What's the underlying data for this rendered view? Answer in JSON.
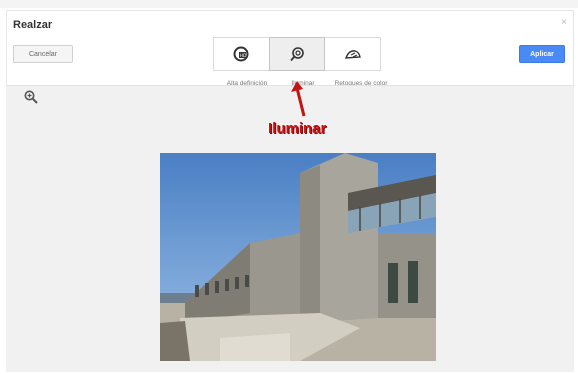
{
  "dialog": {
    "title": "Realzar",
    "close_glyph": "×",
    "cancel_label": "Cancelar",
    "apply_label": "Aplicar"
  },
  "tools": [
    {
      "label": "Alta definición",
      "icon": "hd-enhance-icon",
      "selected": false
    },
    {
      "label": "Iluminar",
      "icon": "illuminate-icon",
      "selected": true
    },
    {
      "label": "Retoques de color",
      "icon": "color-touch-icon",
      "selected": false
    }
  ],
  "annotation": {
    "text": "Iluminar",
    "color": "#c41414"
  },
  "colors": {
    "apply_button": "#4a8af4",
    "preview_background": "#f1f1f1"
  },
  "preview": {
    "zoom_icon": "zoom-in-icon",
    "image": "photo of a modern stone building under a blue sky"
  }
}
